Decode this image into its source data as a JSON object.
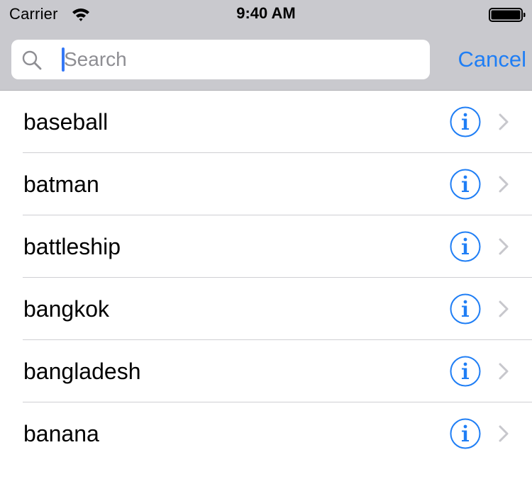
{
  "status_bar": {
    "carrier": "Carrier",
    "time": "9:40 AM",
    "icons": [
      "wifi-icon",
      "battery-icon"
    ]
  },
  "search": {
    "placeholder": "Search",
    "value": "",
    "cancel_label": "Cancel",
    "icon": "search-icon"
  },
  "results": [
    {
      "label": "baseball"
    },
    {
      "label": "batman"
    },
    {
      "label": "battleship"
    },
    {
      "label": "bangkok"
    },
    {
      "label": "bangladesh"
    },
    {
      "label": "banana"
    }
  ],
  "row_accessories": [
    "info-icon",
    "chevron-right-icon"
  ],
  "colors": {
    "accent": "#1f7ef5",
    "bar_background": "#c9c9ce",
    "caret": "#3478f6",
    "placeholder": "#8e8e93",
    "chevron": "#c7c7cc",
    "separator": "#cfcfd3"
  }
}
